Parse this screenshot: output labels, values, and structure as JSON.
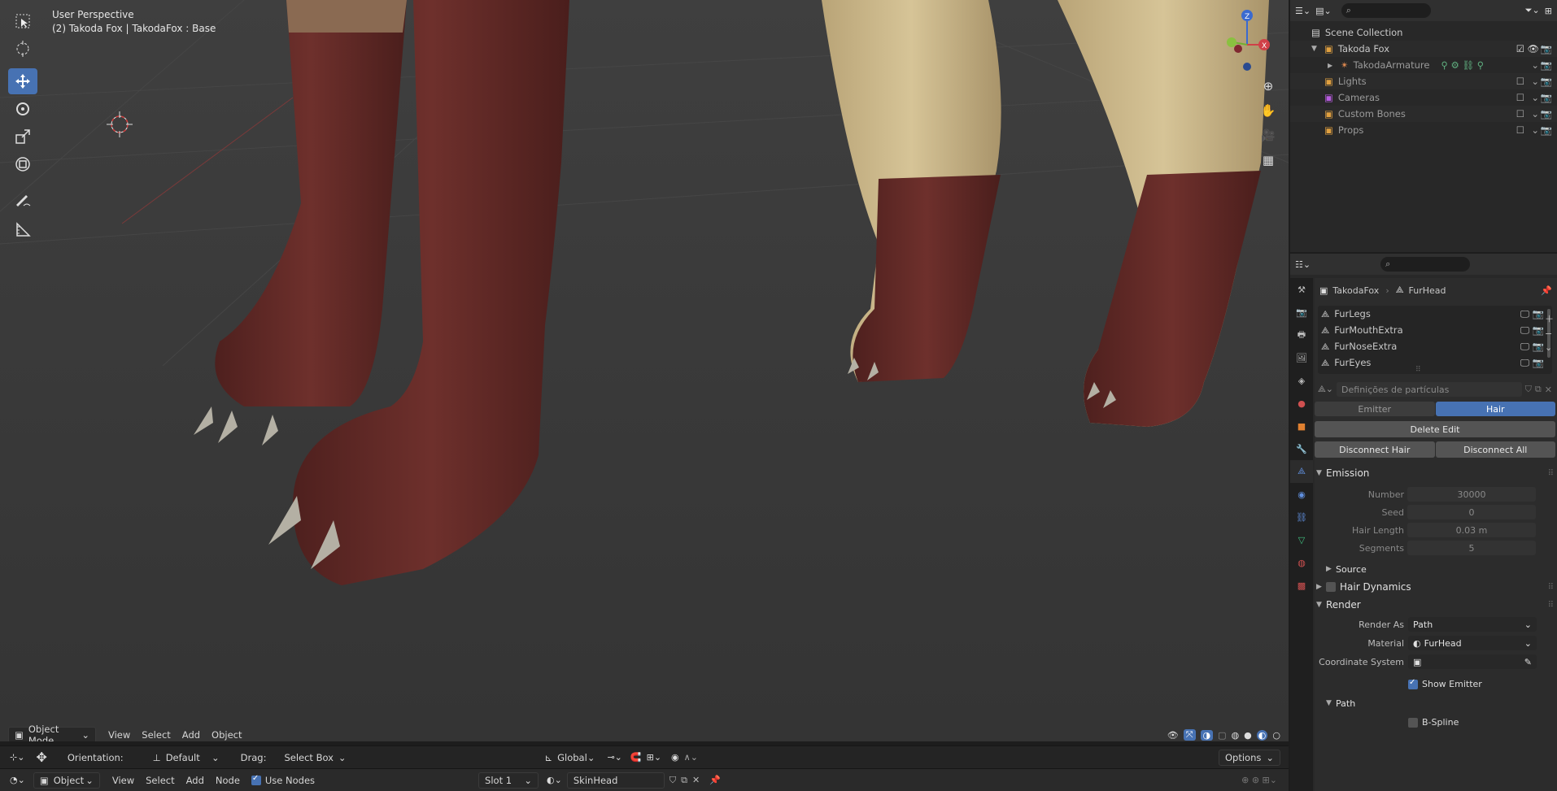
{
  "viewport": {
    "title": "User Perspective",
    "subtitle": "(2) Takoda Fox | TakodaFox : Base",
    "mode": "Object Mode",
    "menus": [
      "View",
      "Select",
      "Add",
      "Object"
    ],
    "gizmo_axes": {
      "z": "Z",
      "y": "Y",
      "x": "X"
    }
  },
  "tool_settings": {
    "orientation_label": "Orientation:",
    "orientation_value": "Default",
    "drag_label": "Drag:",
    "drag_value": "Select Box",
    "transform_orientation": "Global",
    "options": "Options"
  },
  "node_header": {
    "mode": "Object",
    "menus": [
      "View",
      "Select",
      "Add",
      "Node"
    ],
    "use_nodes": "Use Nodes",
    "slot": "Slot 1",
    "material": "SkinHead"
  },
  "outliner": {
    "root": "Scene Collection",
    "items": [
      {
        "label": "Takoda Fox",
        "level": 1,
        "color": "#e0a040"
      },
      {
        "label": "TakodaArmature",
        "level": 2,
        "color": "#e08a50"
      },
      {
        "label": "Lights",
        "level": 1,
        "color": "#e0a040"
      },
      {
        "label": "Cameras",
        "level": 1,
        "color": "#b85ce0"
      },
      {
        "label": "Custom Bones",
        "level": 1,
        "color": "#e0a040"
      },
      {
        "label": "Props",
        "level": 1,
        "color": "#e0a040"
      }
    ]
  },
  "properties": {
    "breadcrumb_object": "TakodaFox",
    "breadcrumb_system": "FurHead",
    "particle_systems": [
      "FurLegs",
      "FurMouthExtra",
      "FurNoseExtra",
      "FurEyes"
    ],
    "settings_placeholder": "Definições de partículas",
    "type_tabs": [
      "Emitter",
      "Hair"
    ],
    "delete_edit": "Delete Edit",
    "disconnect_hair": "Disconnect Hair",
    "disconnect_all": "Disconnect All",
    "emission": {
      "header": "Emission",
      "number_label": "Number",
      "number": "30000",
      "seed_label": "Seed",
      "seed": "0",
      "hair_length_label": "Hair Length",
      "hair_length": "0.03 m",
      "segments_label": "Segments",
      "segments": "5"
    },
    "source": "Source",
    "hair_dynamics": "Hair Dynamics",
    "render": {
      "header": "Render",
      "render_as_label": "Render As",
      "render_as": "Path",
      "material_label": "Material",
      "material": "FurHead",
      "coord_label": "Coordinate System",
      "show_emitter": "Show Emitter"
    },
    "path_header": "Path",
    "bspline": "B-Spline"
  },
  "colors": {
    "accent": "#4772b3",
    "fur_red": "#6a2f2c",
    "fur_tan": "#c9b48a"
  }
}
